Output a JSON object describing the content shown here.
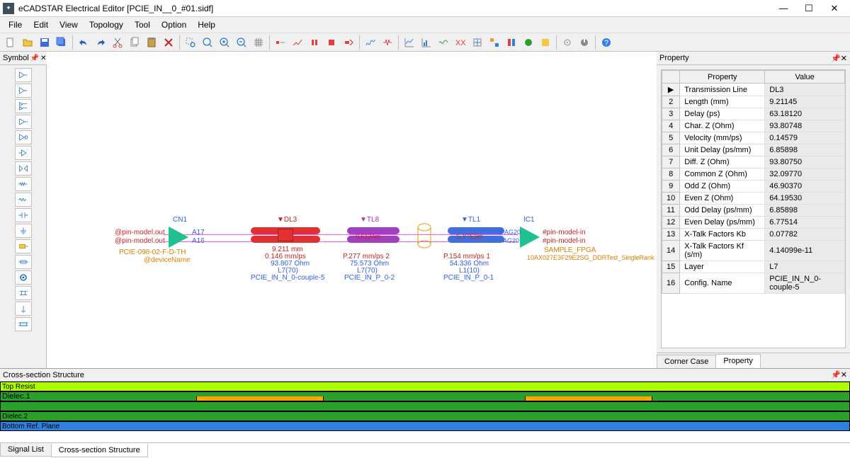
{
  "title": "eCADSTAR Electrical Editor [PCIE_IN__0_#01.sidf]",
  "menu": [
    "File",
    "Edit",
    "View",
    "Topology",
    "Tool",
    "Option",
    "Help"
  ],
  "symbol_panel": {
    "title": "Symbol"
  },
  "property_panel": {
    "title": "Property",
    "columns": [
      "Property",
      "Value"
    ],
    "rows": [
      {
        "n": "▶",
        "key": "Transmission Line",
        "val": "DL3"
      },
      {
        "n": "2",
        "key": "Length (mm)",
        "val": "9.21145"
      },
      {
        "n": "3",
        "key": "Delay (ps)",
        "val": "63.18120"
      },
      {
        "n": "4",
        "key": "Char. Z (Ohm)",
        "val": "93.80748"
      },
      {
        "n": "5",
        "key": "Velocity (mm/ps)",
        "val": "0.14579"
      },
      {
        "n": "6",
        "key": "Unit Delay (ps/mm)",
        "val": "6.85898"
      },
      {
        "n": "7",
        "key": "Diff. Z (Ohm)",
        "val": "93.80750"
      },
      {
        "n": "8",
        "key": "Common Z (Ohm)",
        "val": "32.09770"
      },
      {
        "n": "9",
        "key": "Odd Z (Ohm)",
        "val": "46.90370"
      },
      {
        "n": "10",
        "key": "Even Z (Ohm)",
        "val": "64.19530"
      },
      {
        "n": "11",
        "key": "Odd Delay (ps/mm)",
        "val": "6.85898"
      },
      {
        "n": "12",
        "key": "Even Delay (ps/mm)",
        "val": "6.77514"
      },
      {
        "n": "13",
        "key": "X-Talk Factors Kb",
        "val": "0.07782"
      },
      {
        "n": "14",
        "key": "X-Talk Factors Kf (s/m)",
        "val": "4.14099e-11"
      },
      {
        "n": "15",
        "key": "Layer",
        "val": "L7"
      },
      {
        "n": "16",
        "key": "Config. Name",
        "val": "PCIE_IN_N_0-couple-5"
      }
    ],
    "tabs": [
      "Corner Case",
      "Property"
    ],
    "active_tab": 1
  },
  "cross_section": {
    "title": "Cross-section Structure",
    "layers": [
      "Top Resist",
      "Dielec.1",
      "",
      "Dielec.2",
      "Bottom Ref. Plane"
    ]
  },
  "bottom_tabs": {
    "tabs": [
      "Signal List",
      "Cross-section Structure"
    ],
    "active": 1
  },
  "schematic": {
    "cn1": "CN1",
    "pin_out1": "@pin-model.out",
    "pin_out2": "@pin-model.out",
    "dev1": "PCIE-098-02-F-D-TH",
    "dev1b": "@deviceName",
    "a17": "A17",
    "a16": "A16",
    "dl3_label": "▼DL3",
    "dl3_len": "9.211 mm",
    "dl3_vel": "0.146 mm/ps",
    "dl3_z": "93.807 Ohm",
    "dl3_layer": "L7(70)",
    "dl3_cfg": "PCIE_IN_N_0-couple-5",
    "tl8_label": "▼TL8",
    "tl8_t1": "0.6134m",
    "tl8_t3": "P.277 mm/ps 2",
    "tl8_t4": "75.573 Ohm",
    "tl8_layer": "L7(70)",
    "tl8_cfg": "PCIE_IN_P_0-2",
    "tl1_label": "▼TL1",
    "tl1_t1": "S.Y7E9m",
    "tl1_t3": "P.154 mm/ps 1",
    "tl1_t4": "54.336 Ohm",
    "tl1_layer": "L1(10)",
    "tl1_cfg": "PCIE_IN_P_0-1",
    "ic1": "IC1",
    "ag20_1": "B AG20",
    "ag20_2": "AG20",
    "pin_in1": "#pin-model-in",
    "pin_in2": "#pin-model-in",
    "fpga": "SAMPLE_FPGA",
    "fpga_sub": "10AX027E3F29E2SG_DDRTest_SingleRank"
  }
}
